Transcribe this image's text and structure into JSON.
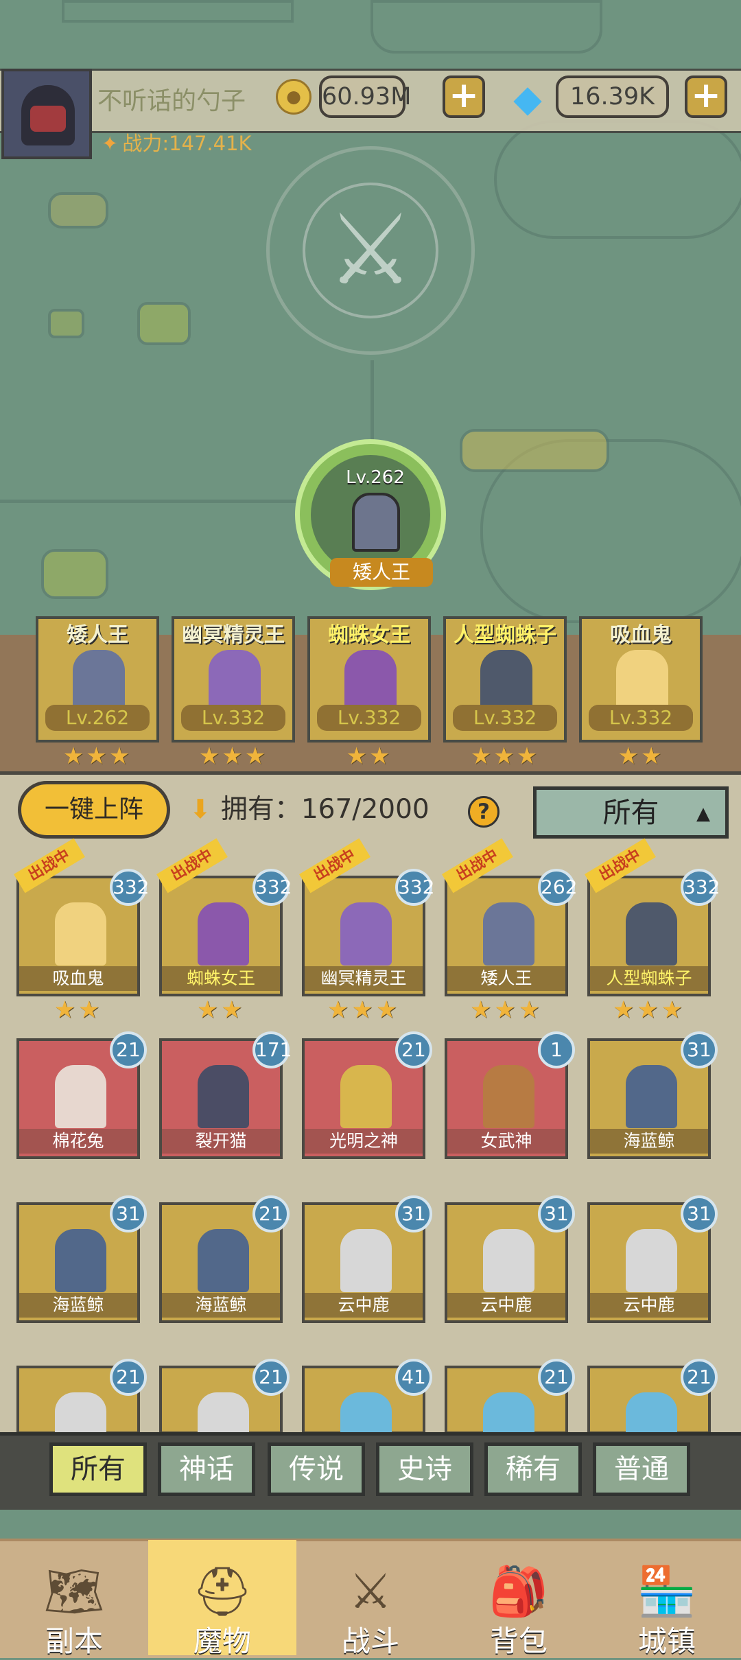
{
  "header": {
    "player_name": "不听话的勺子",
    "power_label": "战力:147.41K",
    "gold_amount": "60.93M",
    "diamond_amount": "16.39K",
    "plus_label": "+"
  },
  "featured_hero": {
    "level": "Lv.262",
    "name": "矮人王"
  },
  "formation": [
    {
      "name": "矮人王",
      "level": "Lv.262",
      "stars": "★★★",
      "yellow": false,
      "color": "#6b7698"
    },
    {
      "name": "幽冥精灵王",
      "level": "Lv.332",
      "stars": "★★★",
      "yellow": false,
      "color": "#8c69b8"
    },
    {
      "name": "蜘蛛女王",
      "level": "Lv.332",
      "stars": "★★",
      "yellow": true,
      "color": "#8b58ab"
    },
    {
      "name": "人型蜘蛛子",
      "level": "Lv.332",
      "stars": "★★★",
      "yellow": true,
      "color": "#4f596b"
    },
    {
      "name": "吸血鬼",
      "level": "Lv.332",
      "stars": "★★",
      "yellow": false,
      "color": "#f0d27f"
    }
  ],
  "controls": {
    "one_key_deploy": "一键上阵",
    "owned_label": "拥有：",
    "owned_count": "167/2000",
    "help_icon": "?",
    "filter_value": "所有"
  },
  "monsters": [
    {
      "name": "吸血鬼",
      "level": "332",
      "tag": "出战中",
      "stars": "★★",
      "bg": "gold",
      "yellow": false,
      "color": "#f0d27f"
    },
    {
      "name": "蜘蛛女王",
      "level": "332",
      "tag": "出战中",
      "stars": "★★",
      "bg": "gold",
      "yellow": true,
      "color": "#8b58ab"
    },
    {
      "name": "幽冥精灵王",
      "level": "332",
      "tag": "出战中",
      "stars": "★★★",
      "bg": "gold",
      "yellow": false,
      "color": "#8c69b8"
    },
    {
      "name": "矮人王",
      "level": "262",
      "tag": "出战中",
      "stars": "★★★",
      "bg": "gold",
      "yellow": false,
      "color": "#6b7698"
    },
    {
      "name": "人型蜘蛛子",
      "level": "332",
      "tag": "出战中",
      "stars": "★★★",
      "bg": "gold",
      "yellow": true,
      "color": "#4f596b"
    },
    {
      "name": "棉花兔",
      "level": "21",
      "tag": "",
      "stars": "",
      "bg": "red",
      "yellow": false,
      "color": "#e7d7cf"
    },
    {
      "name": "裂开猫",
      "level": "171",
      "tag": "",
      "stars": "",
      "bg": "red",
      "yellow": false,
      "color": "#4b4d65"
    },
    {
      "name": "光明之神",
      "level": "21",
      "tag": "",
      "stars": "",
      "bg": "red",
      "yellow": false,
      "color": "#d8b64d"
    },
    {
      "name": "女武神",
      "level": "1",
      "tag": "",
      "stars": "",
      "bg": "red",
      "yellow": false,
      "color": "#b77b43"
    },
    {
      "name": "海蓝鲸",
      "level": "31",
      "tag": "",
      "stars": "",
      "bg": "gold",
      "yellow": false,
      "color": "#52688a"
    },
    {
      "name": "海蓝鲸",
      "level": "31",
      "tag": "",
      "stars": "",
      "bg": "gold",
      "yellow": false,
      "color": "#52688a"
    },
    {
      "name": "海蓝鲸",
      "level": "21",
      "tag": "",
      "stars": "",
      "bg": "gold",
      "yellow": false,
      "color": "#52688a"
    },
    {
      "name": "云中鹿",
      "level": "31",
      "tag": "",
      "stars": "",
      "bg": "gold",
      "yellow": false,
      "color": "#d7d7d7"
    },
    {
      "name": "云中鹿",
      "level": "31",
      "tag": "",
      "stars": "",
      "bg": "gold",
      "yellow": false,
      "color": "#d7d7d7"
    },
    {
      "name": "云中鹿",
      "level": "31",
      "tag": "",
      "stars": "",
      "bg": "gold",
      "yellow": false,
      "color": "#d7d7d7"
    },
    {
      "name": "",
      "level": "21",
      "tag": "",
      "stars": "",
      "bg": "gold",
      "yellow": false,
      "color": "#d7d7d7"
    },
    {
      "name": "",
      "level": "21",
      "tag": "",
      "stars": "",
      "bg": "gold",
      "yellow": false,
      "color": "#d7d7d7"
    },
    {
      "name": "",
      "level": "41",
      "tag": "",
      "stars": "",
      "bg": "gold",
      "yellow": false,
      "color": "#6bb9dc"
    },
    {
      "name": "",
      "level": "21",
      "tag": "",
      "stars": "",
      "bg": "gold",
      "yellow": false,
      "color": "#6bb9dc"
    },
    {
      "name": "",
      "level": "21",
      "tag": "",
      "stars": "",
      "bg": "gold",
      "yellow": false,
      "color": "#6bb9dc"
    }
  ],
  "rarity_tabs": [
    "所有",
    "神话",
    "传说",
    "史诗",
    "稀有",
    "普通"
  ],
  "bottom_nav": [
    {
      "label": "副本",
      "icon": "map-icon"
    },
    {
      "label": "魔物",
      "icon": "helmet-icon"
    },
    {
      "label": "战斗",
      "icon": "crossed-swords-icon"
    },
    {
      "label": "背包",
      "icon": "backpack-icon"
    },
    {
      "label": "城镇",
      "icon": "shop-icon"
    }
  ],
  "colors": {
    "map": "#6f9480",
    "accent_gold": "#f2bf37",
    "active_nav": "#f7d878"
  }
}
